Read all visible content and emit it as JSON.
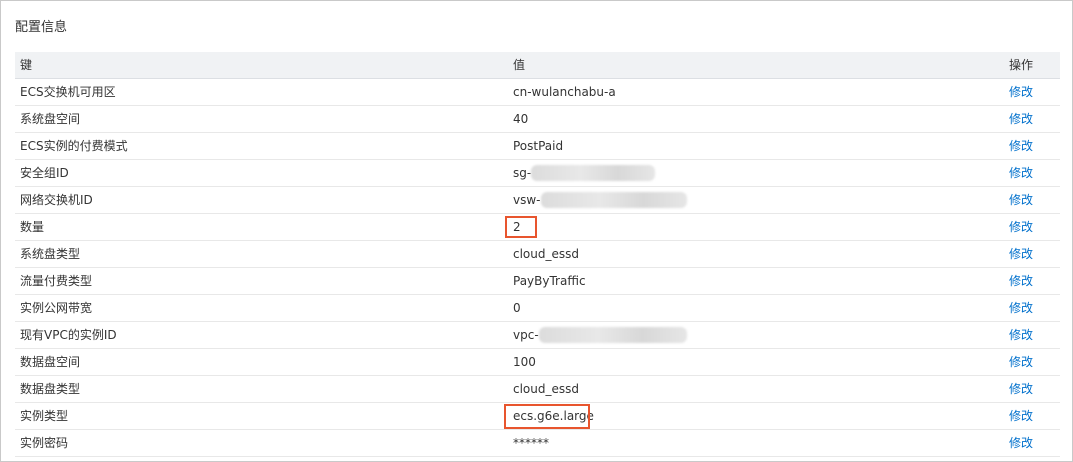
{
  "panel": {
    "title": "配置信息"
  },
  "table": {
    "headers": {
      "key": "键",
      "value": "值",
      "action": "操作"
    },
    "action_label": "修改",
    "rows": [
      {
        "key": "ECS交换机可用区",
        "value": "cn-wulanchabu-a"
      },
      {
        "key": "系统盘空间",
        "value": "40"
      },
      {
        "key": "ECS实例的付费模式",
        "value": "PostPaid"
      },
      {
        "key": "安全组ID",
        "value": "sg-",
        "redacted": true
      },
      {
        "key": "网络交换机ID",
        "value": "vsw-",
        "redacted": true
      },
      {
        "key": "数量",
        "value": "2",
        "highlighted": true
      },
      {
        "key": "系统盘类型",
        "value": "cloud_essd"
      },
      {
        "key": "流量付费类型",
        "value": "PayByTraffic"
      },
      {
        "key": "实例公网带宽",
        "value": "0"
      },
      {
        "key": "现有VPC的实例ID",
        "value": "vpc-",
        "redacted": true
      },
      {
        "key": "数据盘空间",
        "value": "100"
      },
      {
        "key": "数据盘类型",
        "value": "cloud_essd"
      },
      {
        "key": "实例类型",
        "value": "ecs.g6e.large",
        "highlighted": true
      },
      {
        "key": "实例密码",
        "value": "******"
      }
    ]
  },
  "colors": {
    "link": "#0070cc",
    "highlight": "#e8552e",
    "header_bg": "#f0f2f4"
  }
}
